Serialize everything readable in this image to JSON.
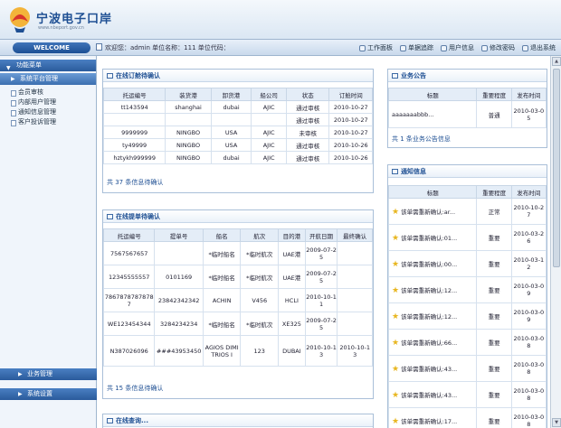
{
  "header": {
    "logo_title": "宁波电子口岸",
    "logo_sub": "www.nbeport.gov.cn"
  },
  "topbar": {
    "welcome_label": "WELCOME",
    "welcome_text": "欢迎您：admin  单位名称：111  单位代码：",
    "links": [
      "工作面板",
      "单据追踪",
      "用户信息",
      "修改密码",
      "退出系统"
    ]
  },
  "sidebar": {
    "head": "功能菜单",
    "sub": "系统平台管理",
    "items": [
      "会员审核",
      "内部用户管理",
      "通知信息管理",
      "客户投诉管理"
    ],
    "bottom": [
      "业务管理",
      "系统设置"
    ]
  },
  "order_panel": {
    "title": "在线订舱待确认",
    "columns": [
      "托运编号",
      "装货港",
      "卸货港",
      "船公司",
      "状态",
      "订舱时间"
    ],
    "rows": [
      [
        "tt143594",
        "shanghai",
        "dubai",
        "AJIC",
        "通过审核",
        "2010-10-27"
      ],
      [
        "",
        "",
        "",
        "",
        "通过审核",
        "2010-10-27"
      ],
      [
        "9999999",
        "NINGBO",
        "USA",
        "AJIC",
        "未审核",
        "2010-10-27"
      ],
      [
        "ty49999",
        "NINGBO",
        "USA",
        "AJIC",
        "通过审核",
        "2010-10-26"
      ],
      [
        "hztykh999999",
        "NINGBO",
        "dubai",
        "AJIC",
        "通过审核",
        "2010-10-26"
      ]
    ],
    "footer": "共 37 条信息待确认"
  },
  "bill_panel": {
    "title": "在线提单待确认",
    "columns": [
      "托运编号",
      "提单号",
      "船名",
      "航次",
      "目的港",
      "开航日期",
      "最终确认"
    ],
    "rows": [
      [
        "7567567657",
        "",
        "*临时船名",
        "*临时航次",
        "UAE港",
        "2009-07-25",
        ""
      ],
      [
        "12345555557",
        "0101169",
        "*临时船名",
        "*临时航次",
        "UAE港",
        "2009-07-25",
        ""
      ],
      [
        "78678787878787",
        "23842342342",
        "ACHIN",
        "V456",
        "HCLI",
        "2010-10-11",
        ""
      ],
      [
        "WE123454344",
        "3284234234",
        "*临时船名",
        "*临时航次",
        "XE325",
        "2009-07-25",
        ""
      ],
      [
        "N387026096",
        "###43953450",
        "AGIOS DIMITRIOS I",
        "123",
        "DUBAI",
        "2010-10-13",
        "2010-10-13"
      ]
    ],
    "footer": "共 15 条信息待确认"
  },
  "notice_panel": {
    "title": "业务公告",
    "columns": [
      "标题",
      "重要程度",
      "发布时间"
    ],
    "rows": [
      [
        "aaaaaaabbb...",
        "普通",
        "2010-03-05"
      ]
    ],
    "footer": "共 1 条业务公告信息"
  },
  "info_panel": {
    "title": "通知信息",
    "columns": [
      "标题",
      "重要程度",
      "发布时间"
    ],
    "rows": [
      [
        "该单需重新确认:ar...",
        "正常",
        "2010-10-27"
      ],
      [
        "该单需重新确认:01...",
        "重要",
        "2010-03-26"
      ],
      [
        "该单需重新确认:00...",
        "重要",
        "2010-03-12"
      ],
      [
        "该单需重新确认:12...",
        "重要",
        "2010-03-09"
      ],
      [
        "该单需重新确认:12...",
        "重要",
        "2010-03-09"
      ],
      [
        "该单需重新确认:66...",
        "重要",
        "2010-03-08"
      ],
      [
        "该单需重新确认:43...",
        "重要",
        "2010-03-08"
      ],
      [
        "该单需重新确认:43...",
        "重要",
        "2010-03-08"
      ],
      [
        "该单需重新确认:17...",
        "重要",
        "2010-03-08"
      ]
    ]
  },
  "bottom_panel": {
    "title": "在线查询..."
  }
}
